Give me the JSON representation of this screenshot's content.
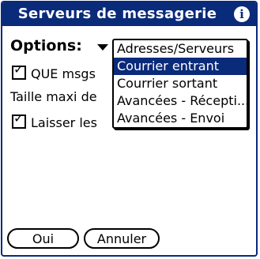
{
  "window": {
    "title": "Serveurs de messagerie",
    "info_icon": "i"
  },
  "options": {
    "label": "Options:"
  },
  "rows": {
    "que_msgs": {
      "label": "QUE msgs",
      "checked": true
    },
    "taille": {
      "label": "Taille maxi de"
    },
    "laisser": {
      "label": "Laisser les",
      "checked": true
    }
  },
  "checkmark": "✓",
  "dropdown": {
    "items": [
      {
        "label": "Adresses/Serveurs",
        "selected": false
      },
      {
        "label": "Courrier entrant",
        "selected": true
      },
      {
        "label": "Courrier sortant",
        "selected": false
      },
      {
        "label": "Avancées - Récepti...",
        "selected": false
      },
      {
        "label": "Avancées - Envoi",
        "selected": false
      }
    ]
  },
  "buttons": {
    "ok_label": "Oui",
    "cancel_label": "Annuler"
  },
  "colors": {
    "title_bg": "#0a2a7a",
    "selection_bg": "#0a2a7a",
    "text": "#000000"
  }
}
